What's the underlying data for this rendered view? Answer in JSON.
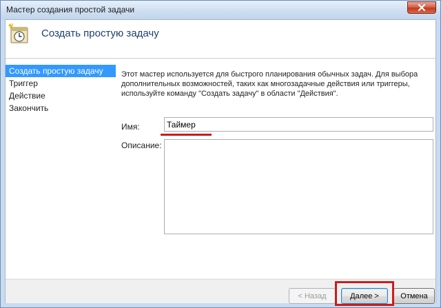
{
  "window": {
    "title": "Мастер создания простой задачи"
  },
  "header": {
    "title": "Создать простую задачу",
    "icon": "scheduler-clock-icon"
  },
  "steps": [
    {
      "label": "Создать простую задачу",
      "active": true
    },
    {
      "label": "Триггер",
      "active": false
    },
    {
      "label": "Действие",
      "active": false
    },
    {
      "label": "Закончить",
      "active": false
    }
  ],
  "main": {
    "description_lines": [
      "Этот мастер используется для быстрого планирования обычных задач.  Для выбора",
      "дополнительных возможностей, таких как многозадачные действия или триггеры,",
      "используйте команду \"Создать задачу\" в области \"Действия\"."
    ],
    "name_label": "Имя:",
    "name_value": "Таймер",
    "description_label": "Описание:",
    "description_value": ""
  },
  "footer": {
    "back_label": "< Назад",
    "next_label": "Далее >",
    "cancel_label": "Отмена"
  },
  "colors": {
    "highlight": "#3399ff",
    "annotation_red": "#cc1b1b",
    "header_title": "#1c3f6e"
  }
}
